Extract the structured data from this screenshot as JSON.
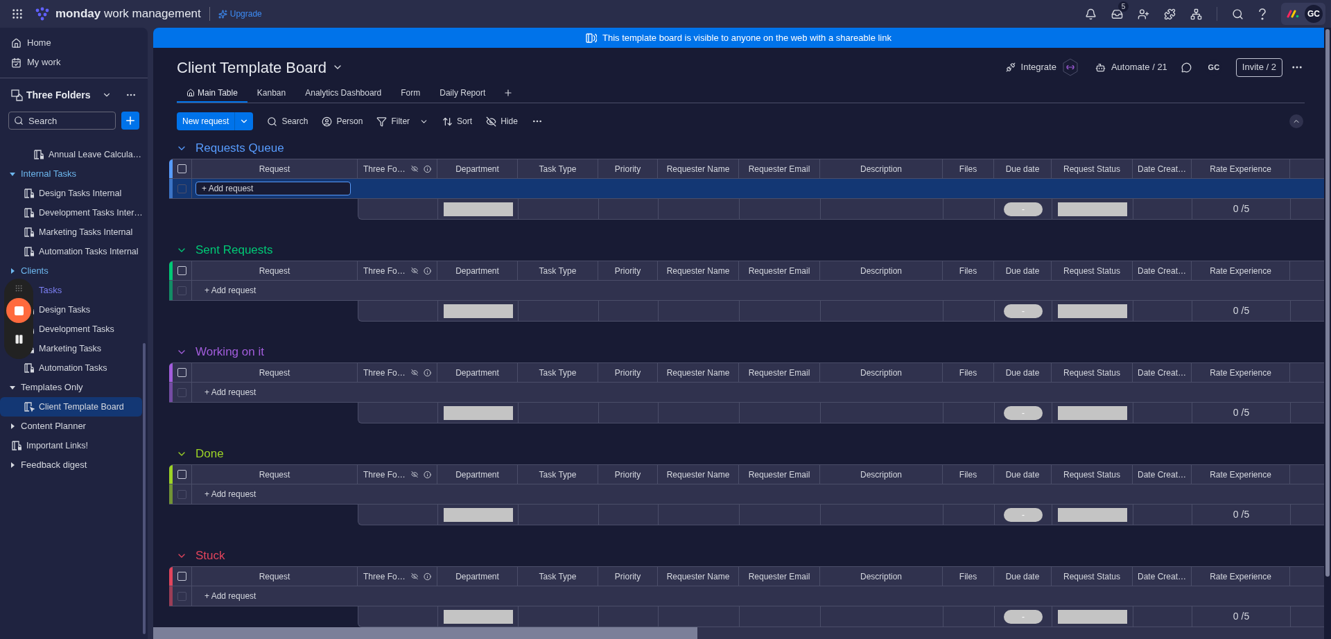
{
  "top_bar": {
    "logo_bold": "monday",
    "logo_rest": "work management",
    "upgrade": "Upgrade",
    "inbox_badge": "5",
    "avatar": "GC"
  },
  "sidebar": {
    "nav": [
      {
        "kind": "home",
        "label": "Home"
      },
      {
        "kind": "mywork",
        "label": "My work"
      }
    ],
    "workspace": "Three Folders",
    "search": {
      "placeholder": "Search"
    },
    "continued_folder": {
      "children": [
        {
          "label": "Annual Leave Calcula…",
          "selected": false
        }
      ]
    },
    "tree": [
      {
        "kind": "folder",
        "label": "Internal Tasks",
        "color": "#6db7ee",
        "expanded": true,
        "covered": false,
        "children": [
          {
            "kind": "board",
            "label": "Design Tasks Internal",
            "selected": false
          },
          {
            "kind": "board",
            "label": "Development Tasks Inter…",
            "selected": false
          },
          {
            "kind": "board",
            "label": "Marketing Tasks Internal",
            "selected": false
          },
          {
            "kind": "board",
            "label": "Automation Tasks Internal",
            "selected": false
          }
        ]
      },
      {
        "kind": "folder",
        "label": "Clients",
        "color": "#6db7ee",
        "expanded": false,
        "covered": false
      },
      {
        "kind": "folder",
        "label": "Tasks",
        "color": "#7c7ff2",
        "expanded": true,
        "covered": true,
        "children": [
          {
            "kind": "board",
            "label": "Design Tasks",
            "selected": false
          },
          {
            "kind": "board",
            "label": "Development Tasks",
            "selected": false
          },
          {
            "kind": "board",
            "label": "Marketing Tasks",
            "selected": false
          },
          {
            "kind": "board",
            "label": "Automation Tasks",
            "selected": false
          }
        ]
      },
      {
        "kind": "folder",
        "label": "Templates Only",
        "color": "#d5d8df",
        "expanded": true,
        "covered": false,
        "children": [
          {
            "kind": "template",
            "label": "Client Template Board",
            "selected": true
          }
        ]
      },
      {
        "kind": "folder",
        "label": "Content Planner",
        "color": "#d5d8df",
        "expanded": false,
        "covered": false
      },
      {
        "kind": "board",
        "label": "Important Links!",
        "selected": false
      },
      {
        "kind": "folder",
        "label": "Feedback digest",
        "color": "#d5d8df",
        "expanded": false,
        "covered": false
      }
    ]
  },
  "banner": "This template board is visible to anyone on the web with a shareable link",
  "board": {
    "title": "Client Template Board",
    "integrate": "Integrate",
    "automate": "Automate / 21",
    "avatar": "GC",
    "invite": "Invite / 2",
    "tabs": [
      {
        "label": "Main Table",
        "selected": true,
        "kind": "home"
      },
      {
        "label": "Kanban",
        "selected": false,
        "kind": "plain"
      },
      {
        "label": "Analytics Dashboard",
        "selected": false,
        "kind": "plain"
      },
      {
        "label": "Form",
        "selected": false,
        "kind": "plain"
      },
      {
        "label": "Daily Report",
        "selected": false,
        "kind": "plain"
      }
    ],
    "toolbar": {
      "new_button": "New request",
      "actions": [
        {
          "kind": "search",
          "label": "Search"
        },
        {
          "kind": "person",
          "label": "Person"
        },
        {
          "kind": "filter",
          "label": "Filter"
        },
        {
          "kind": "sort",
          "label": "Sort"
        },
        {
          "kind": "hide",
          "label": "Hide"
        }
      ]
    }
  },
  "table": {
    "groups": [
      {
        "title": "Requests Queue",
        "color": "#579bfc",
        "checked": false,
        "add_label": "+ Add request",
        "add_checked": false,
        "editing": true,
        "columns": [
          {
            "label": "Request",
            "kind": "plain"
          },
          {
            "label": "Three Fo…",
            "kind": "icons"
          },
          {
            "label": "Department",
            "kind": "plain"
          },
          {
            "label": "Task Type",
            "kind": "plain"
          },
          {
            "label": "Priority",
            "kind": "plain"
          },
          {
            "label": "Requester Name",
            "kind": "plain"
          },
          {
            "label": "Requester Email",
            "kind": "plain"
          },
          {
            "label": "Description",
            "kind": "plain"
          },
          {
            "label": "Files",
            "kind": "plain"
          },
          {
            "label": "Due date",
            "kind": "plain"
          },
          {
            "label": "Request Status",
            "kind": "plain"
          },
          {
            "label": "Date Creat…",
            "kind": "plain"
          },
          {
            "label": "Rate Experience",
            "kind": "plain"
          }
        ],
        "summary": [
          {
            "kind": "empty"
          },
          {
            "kind": "bar"
          },
          {
            "kind": "empty"
          },
          {
            "kind": "empty"
          },
          {
            "kind": "empty"
          },
          {
            "kind": "empty"
          },
          {
            "kind": "empty"
          },
          {
            "kind": "empty"
          },
          {
            "kind": "pill",
            "text": "-"
          },
          {
            "kind": "bar"
          },
          {
            "kind": "empty"
          },
          {
            "kind": "text",
            "text": "0 /5"
          }
        ]
      },
      {
        "title": "Sent Requests",
        "color": "#00c875",
        "checked": false,
        "add_label": "+ Add request",
        "add_checked": false,
        "editing": false,
        "columns": [
          {
            "label": "Request",
            "kind": "plain"
          },
          {
            "label": "Three Fo…",
            "kind": "icons"
          },
          {
            "label": "Department",
            "kind": "plain"
          },
          {
            "label": "Task Type",
            "kind": "plain"
          },
          {
            "label": "Priority",
            "kind": "plain"
          },
          {
            "label": "Requester Name",
            "kind": "plain"
          },
          {
            "label": "Requester Email",
            "kind": "plain"
          },
          {
            "label": "Description",
            "kind": "plain"
          },
          {
            "label": "Files",
            "kind": "plain"
          },
          {
            "label": "Due date",
            "kind": "plain"
          },
          {
            "label": "Request Status",
            "kind": "plain"
          },
          {
            "label": "Date Creat…",
            "kind": "plain"
          },
          {
            "label": "Rate Experience",
            "kind": "plain"
          }
        ],
        "summary": [
          {
            "kind": "empty"
          },
          {
            "kind": "bar"
          },
          {
            "kind": "empty"
          },
          {
            "kind": "empty"
          },
          {
            "kind": "empty"
          },
          {
            "kind": "empty"
          },
          {
            "kind": "empty"
          },
          {
            "kind": "empty"
          },
          {
            "kind": "pill",
            "text": "-"
          },
          {
            "kind": "bar"
          },
          {
            "kind": "empty"
          },
          {
            "kind": "text",
            "text": "0 /5"
          }
        ]
      },
      {
        "title": "Working on it",
        "color": "#a25ddc",
        "checked": false,
        "add_label": "+ Add request",
        "add_checked": false,
        "editing": false,
        "columns": [
          {
            "label": "Request",
            "kind": "plain"
          },
          {
            "label": "Three Fo…",
            "kind": "icons"
          },
          {
            "label": "Department",
            "kind": "plain"
          },
          {
            "label": "Task Type",
            "kind": "plain"
          },
          {
            "label": "Priority",
            "kind": "plain"
          },
          {
            "label": "Requester Name",
            "kind": "plain"
          },
          {
            "label": "Requester Email",
            "kind": "plain"
          },
          {
            "label": "Description",
            "kind": "plain"
          },
          {
            "label": "Files",
            "kind": "plain"
          },
          {
            "label": "Due date",
            "kind": "plain"
          },
          {
            "label": "Request Status",
            "kind": "plain"
          },
          {
            "label": "Date Creat…",
            "kind": "plain"
          },
          {
            "label": "Rate Experience",
            "kind": "plain"
          }
        ],
        "summary": [
          {
            "kind": "empty"
          },
          {
            "kind": "bar"
          },
          {
            "kind": "empty"
          },
          {
            "kind": "empty"
          },
          {
            "kind": "empty"
          },
          {
            "kind": "empty"
          },
          {
            "kind": "empty"
          },
          {
            "kind": "empty"
          },
          {
            "kind": "pill",
            "text": "-"
          },
          {
            "kind": "bar"
          },
          {
            "kind": "empty"
          },
          {
            "kind": "text",
            "text": "0 /5"
          }
        ]
      },
      {
        "title": "Done",
        "color": "#9cd326",
        "checked": false,
        "add_label": "+ Add request",
        "add_checked": false,
        "editing": false,
        "columns": [
          {
            "label": "Request",
            "kind": "plain"
          },
          {
            "label": "Three Fo…",
            "kind": "icons"
          },
          {
            "label": "Department",
            "kind": "plain"
          },
          {
            "label": "Task Type",
            "kind": "plain"
          },
          {
            "label": "Priority",
            "kind": "plain"
          },
          {
            "label": "Requester Name",
            "kind": "plain"
          },
          {
            "label": "Requester Email",
            "kind": "plain"
          },
          {
            "label": "Description",
            "kind": "plain"
          },
          {
            "label": "Files",
            "kind": "plain"
          },
          {
            "label": "Due date",
            "kind": "plain"
          },
          {
            "label": "Request Status",
            "kind": "plain"
          },
          {
            "label": "Date Creat…",
            "kind": "plain"
          },
          {
            "label": "Rate Experience",
            "kind": "plain"
          }
        ],
        "summary": [
          {
            "kind": "empty"
          },
          {
            "kind": "bar"
          },
          {
            "kind": "empty"
          },
          {
            "kind": "empty"
          },
          {
            "kind": "empty"
          },
          {
            "kind": "empty"
          },
          {
            "kind": "empty"
          },
          {
            "kind": "empty"
          },
          {
            "kind": "pill",
            "text": "-"
          },
          {
            "kind": "bar"
          },
          {
            "kind": "empty"
          },
          {
            "kind": "text",
            "text": "0 /5"
          }
        ]
      },
      {
        "title": "Stuck",
        "color": "#e2445c",
        "checked": false,
        "add_label": "+ Add request",
        "add_checked": false,
        "editing": false,
        "columns": [
          {
            "label": "Request",
            "kind": "plain"
          },
          {
            "label": "Three Fo…",
            "kind": "icons"
          },
          {
            "label": "Department",
            "kind": "plain"
          },
          {
            "label": "Task Type",
            "kind": "plain"
          },
          {
            "label": "Priority",
            "kind": "plain"
          },
          {
            "label": "Requester Name",
            "kind": "plain"
          },
          {
            "label": "Requester Email",
            "kind": "plain"
          },
          {
            "label": "Description",
            "kind": "plain"
          },
          {
            "label": "Files",
            "kind": "plain"
          },
          {
            "label": "Due date",
            "kind": "plain"
          },
          {
            "label": "Request Status",
            "kind": "plain"
          },
          {
            "label": "Date Creat…",
            "kind": "plain"
          },
          {
            "label": "Rate Experience",
            "kind": "plain"
          }
        ],
        "summary": [
          {
            "kind": "empty"
          },
          {
            "kind": "bar"
          },
          {
            "kind": "empty"
          },
          {
            "kind": "empty"
          },
          {
            "kind": "empty"
          },
          {
            "kind": "empty"
          },
          {
            "kind": "empty"
          },
          {
            "kind": "empty"
          },
          {
            "kind": "pill",
            "text": "-"
          },
          {
            "kind": "bar"
          },
          {
            "kind": "empty"
          },
          {
            "kind": "text",
            "text": "0 /5"
          }
        ]
      }
    ]
  }
}
